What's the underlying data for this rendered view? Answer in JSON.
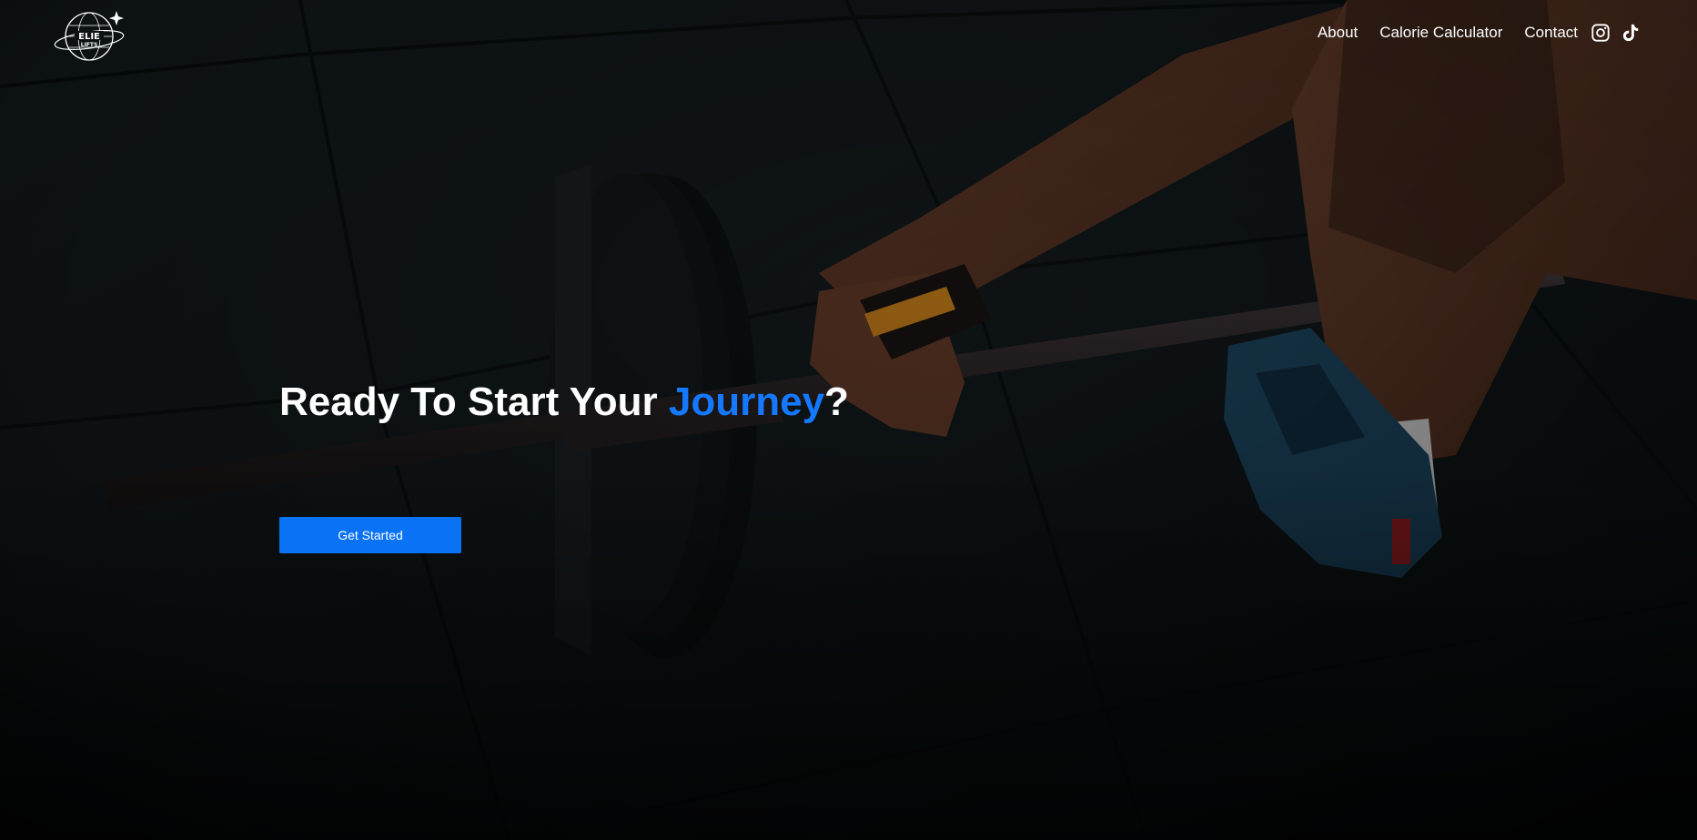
{
  "brand": {
    "logo_line_1": "ELIE",
    "logo_line_2": "LIFTS",
    "logo_name": "globe-logo-icon"
  },
  "nav": {
    "links": [
      {
        "label": "About"
      },
      {
        "label": "Calorie Calculator"
      },
      {
        "label": "Contact"
      }
    ],
    "social": [
      {
        "icon": "instagram-icon"
      },
      {
        "icon": "tiktok-icon"
      }
    ]
  },
  "hero": {
    "headline_prefix": "Ready To Start Your ",
    "headline_accent": "Journey",
    "headline_suffix": "?",
    "cta_label": "Get Started",
    "background_image": "gym-floor-barbell-deadlift-photo"
  },
  "colors": {
    "accent": "#1479ff",
    "button": "#0a72f5",
    "text": "#ffffff",
    "background": "#0d1214"
  }
}
